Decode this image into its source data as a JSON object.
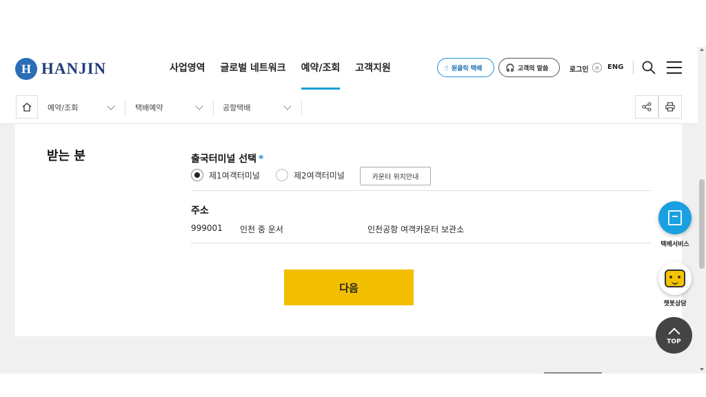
{
  "header": {
    "logo_mark": "H",
    "logo_text": "HANJIN",
    "nav": [
      "사업영역",
      "글로벌 네트워크",
      "예약/조회",
      "고객지원"
    ],
    "oneclick_label": "원클릭 택배",
    "voice_label": "고객의 말씀",
    "login_label": "로그인",
    "lang_label": "ENG"
  },
  "breadcrumb": {
    "items": [
      "예약/조회",
      "택배예약",
      "공항택배"
    ]
  },
  "form": {
    "section_title": "받는 분",
    "terminal_label": "출국터미널 선택",
    "required_mark": "*",
    "terminal_options": [
      "제1여객터미널",
      "제2여객터미널"
    ],
    "selected_terminal": "제1여객터미널",
    "counter_button": "카운터 위치안내",
    "address_label": "주소",
    "zip": "999001",
    "address_line1": "인천 중 운서",
    "address_line2": "인천공항 여객카운터 보관소",
    "next_button": "다음"
  },
  "floating": {
    "parcel_label": "택배서비스",
    "chatbot_label": "챗봇상담",
    "top_label": "TOP"
  },
  "colors": {
    "accent": "#1a9ed6",
    "next_button": "#f2be00",
    "logo": "#243c7a"
  }
}
